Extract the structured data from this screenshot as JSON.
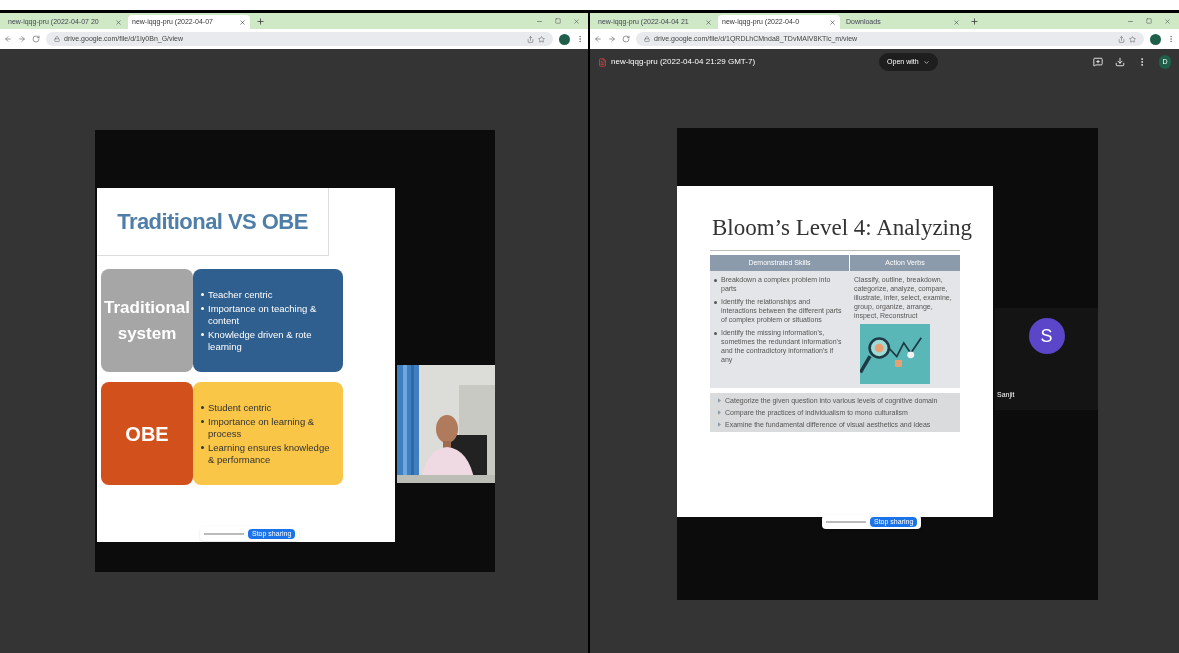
{
  "left_window": {
    "tabs": [
      {
        "label": "new-iqqg-pru (2022-04-07 20",
        "selected": false
      },
      {
        "label": "new-iqqg-pru (2022-04-07",
        "selected": true
      }
    ],
    "address": "drive.google.com/file/d/1Iy0Bn_G/view",
    "slide": {
      "title": "Traditional VS OBE",
      "rows": [
        {
          "kind": "traditional",
          "label": "Traditional system",
          "bullets": [
            "Teacher centric",
            "Importance on  teaching & content",
            "Knowledge driven & rote learning"
          ]
        },
        {
          "kind": "obe",
          "label": "OBE",
          "bullets": [
            "Student centric",
            "Importance on learning & process",
            "Learning ensures knowledge & performance"
          ]
        }
      ]
    },
    "share_bar": {
      "button": "Stop sharing"
    }
  },
  "right_window": {
    "tabs": [
      {
        "label": "new-iqqg-pru (2022-04-04 21",
        "selected": false
      },
      {
        "label": "new-iqqg-pru (2022-04-0",
        "selected": true
      },
      {
        "label": "Downloads",
        "selected": false
      }
    ],
    "address": "drive.google.com/file/d/1QRDLhCMnda8_TDvMAIV8KTlc_m/view",
    "viewer_title": "new-iqqg-pru (2022-04-04 21:29 GMT-7)",
    "open_with": "Open with",
    "account_initial": "D",
    "slide": {
      "title": "Bloom’s Level 4: Analyzing",
      "columns": [
        "Demonstrated Skills",
        "Action Verbs"
      ],
      "skills": [
        "Breakdown a complex problem into parts",
        "Identify the relationships and interactions between the different parts of complex problem or situations",
        "Identify the missing information's, sometimes the redundant information's and the contradictory information's if any"
      ],
      "verbs": "Classify, outline, breakdown, categorize, analyze, compare, illustrate, infer, select, examine, group, organize, arrange, inspect, Reconstruct",
      "examples": [
        "Categorize the given question into various levels of cognitive domain",
        "Compare the practices of individualism to mono culturalism",
        "Examine the fundamental difference of visual aesthetics and ideas"
      ]
    },
    "participant": {
      "initial": "S",
      "name": "Sanjit"
    },
    "share_bar": {
      "button": "Stop sharing"
    }
  }
}
